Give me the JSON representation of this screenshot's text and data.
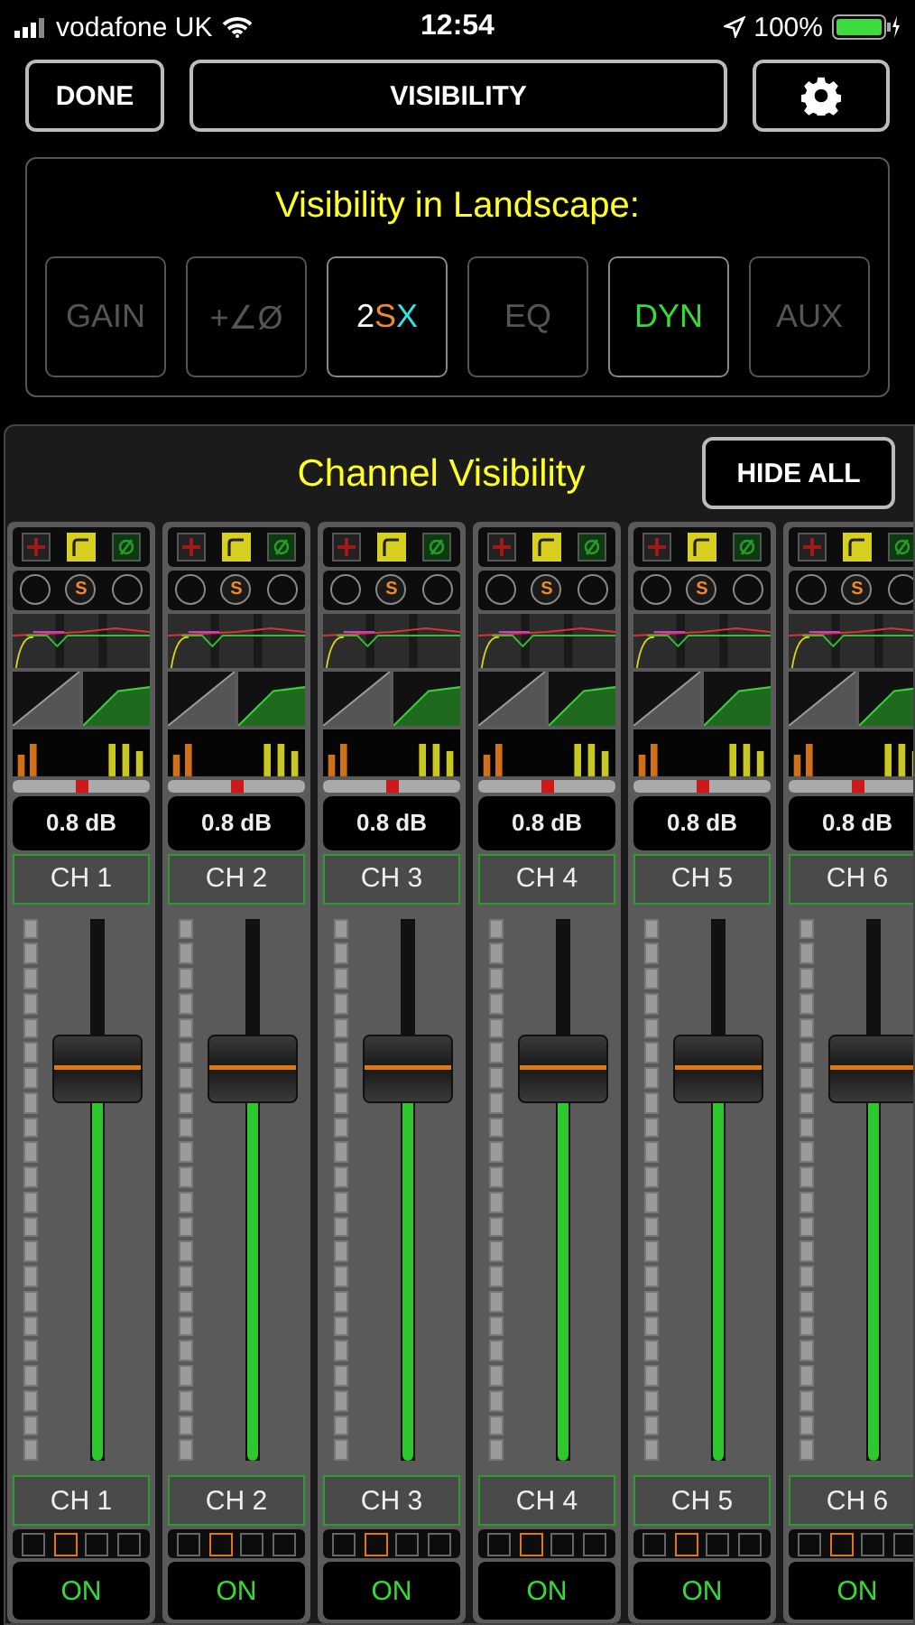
{
  "status_bar": {
    "carrier": "vodafone UK",
    "time": "12:54",
    "battery": "100%"
  },
  "toolbar": {
    "done": "DONE",
    "title": "VISIBILITY"
  },
  "landscape": {
    "title": "Visibility in Landscape:",
    "toggles": [
      {
        "segments": [
          {
            "text": "GAIN",
            "color": "#555555"
          }
        ],
        "on": false
      },
      {
        "segments": [
          {
            "text": "+∠Ø",
            "color": "#555555"
          }
        ],
        "on": false
      },
      {
        "segments": [
          {
            "text": "2",
            "color": "#ffffff"
          },
          {
            "text": "S",
            "color": "#f08a24"
          },
          {
            "text": "X",
            "color": "#2ee6e6"
          }
        ],
        "on": true
      },
      {
        "segments": [
          {
            "text": "EQ",
            "color": "#555555"
          }
        ],
        "on": false
      },
      {
        "segments": [
          {
            "text": "DYN",
            "color": "#33dd33"
          }
        ],
        "on": true
      },
      {
        "segments": [
          {
            "text": "AUX",
            "color": "#555555"
          }
        ],
        "on": false
      }
    ]
  },
  "channel_visibility": {
    "title": "Channel Visibility",
    "hide_all": "HIDE ALL"
  },
  "channels": [
    {
      "solo": "S",
      "gain": "0.8 dB",
      "name": "CH 1",
      "pan": {
        "level": 0.5
      },
      "fader": {
        "level": 0.72
      },
      "footer_name": "CH 1",
      "groups": [
        {
          "selected": false
        },
        {
          "selected": true
        },
        {
          "selected": false
        },
        {
          "selected": false
        }
      ],
      "on_label": "ON",
      "on": true
    },
    {
      "solo": "S",
      "gain": "0.8 dB",
      "name": "CH 2",
      "pan": {
        "level": 0.5
      },
      "fader": {
        "level": 0.72
      },
      "footer_name": "CH 2",
      "groups": [
        {
          "selected": false
        },
        {
          "selected": true
        },
        {
          "selected": false
        },
        {
          "selected": false
        }
      ],
      "on_label": "ON",
      "on": true
    },
    {
      "solo": "S",
      "gain": "0.8 dB",
      "name": "CH 3",
      "pan": {
        "level": 0.5
      },
      "fader": {
        "level": 0.72
      },
      "footer_name": "CH 3",
      "groups": [
        {
          "selected": false
        },
        {
          "selected": true
        },
        {
          "selected": false
        },
        {
          "selected": false
        }
      ],
      "on_label": "ON",
      "on": true
    },
    {
      "solo": "S",
      "gain": "0.8 dB",
      "name": "CH 4",
      "pan": {
        "level": 0.5
      },
      "fader": {
        "level": 0.72
      },
      "footer_name": "CH 4",
      "groups": [
        {
          "selected": false
        },
        {
          "selected": true
        },
        {
          "selected": false
        },
        {
          "selected": false
        }
      ],
      "on_label": "ON",
      "on": true
    },
    {
      "solo": "S",
      "gain": "0.8 dB",
      "name": "CH 5",
      "pan": {
        "level": 0.5
      },
      "fader": {
        "level": 0.72
      },
      "footer_name": "CH 5",
      "groups": [
        {
          "selected": false
        },
        {
          "selected": true
        },
        {
          "selected": false
        },
        {
          "selected": false
        }
      ],
      "on_label": "ON",
      "on": true
    },
    {
      "solo": "S",
      "gain": "0.8 dB",
      "name": "CH 6",
      "pan": {
        "level": 0.5
      },
      "fader": {
        "level": 0.72
      },
      "footer_name": "CH 6",
      "groups": [
        {
          "selected": false
        },
        {
          "selected": true
        },
        {
          "selected": false
        },
        {
          "selected": false
        }
      ],
      "on_label": "ON",
      "on": true
    }
  ]
}
